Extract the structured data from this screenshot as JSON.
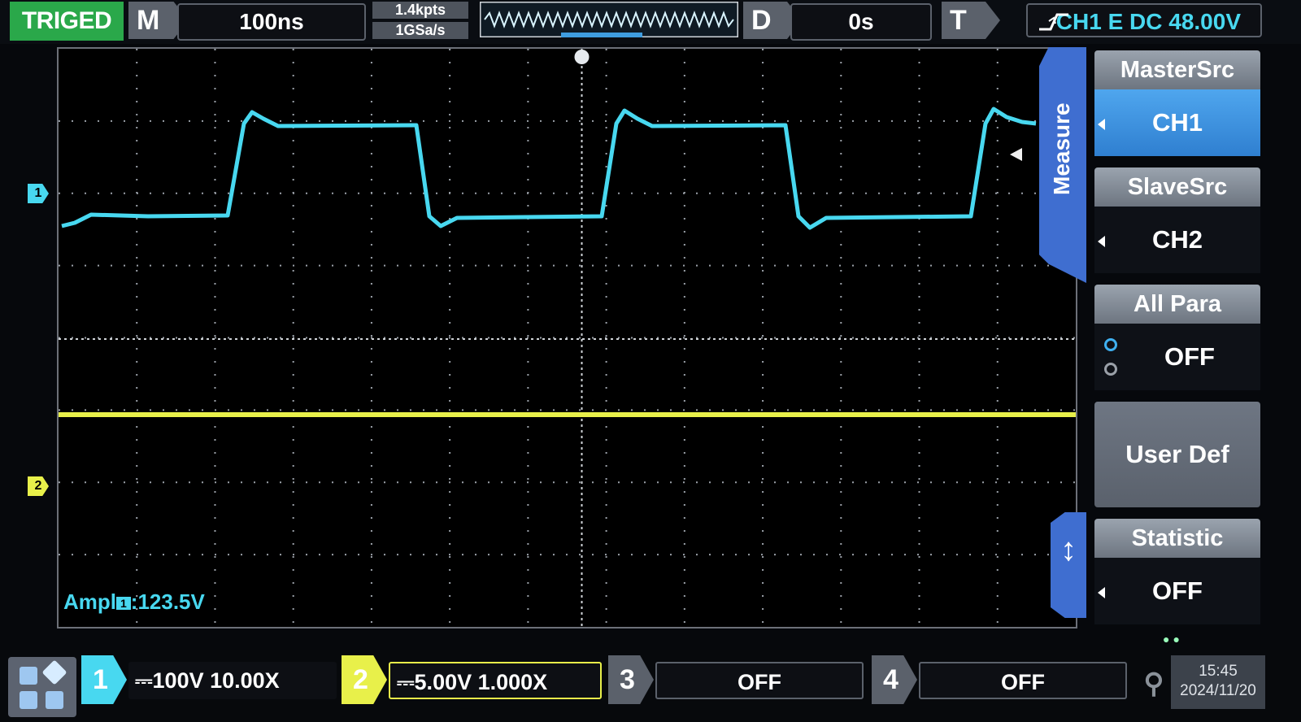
{
  "top_bar": {
    "trigger_status": "TRIGED",
    "timebase_tag": "M",
    "timebase_value": "100ns",
    "memory_depth": "1.4kpts",
    "sample_rate": "1GSa/s",
    "delay_tag": "D",
    "delay_value": "0s",
    "trigger_tag": "T",
    "trigger_source": "CH1 E DC 48.00V"
  },
  "waveform": {
    "ch1_marker": "1",
    "ch2_marker": "2",
    "trigger_marker": "T",
    "measurement_prefix": "Ampl",
    "measurement_channel": "1",
    "measurement_value": ":123.5V",
    "colors": {
      "ch1": "#48d8f0",
      "ch2": "#e8f04a",
      "grid": "#9aa0a8"
    }
  },
  "side_tab": {
    "label": "Measure"
  },
  "menu": {
    "master_src": {
      "label": "MasterSrc",
      "value": "CH1"
    },
    "slave_src": {
      "label": "SlaveSrc",
      "value": "CH2"
    },
    "all_para": {
      "label": "All Para",
      "value": "OFF"
    },
    "user_def": {
      "label": "User Def"
    },
    "statistic": {
      "label": "Statistic",
      "value": "OFF"
    }
  },
  "bottom_bar": {
    "channels": [
      {
        "num": "1",
        "setting": "⎓100V 10.00X",
        "color": "#48d8f0"
      },
      {
        "num": "2",
        "setting": "⎓5.00V 1.000X",
        "color": "#e8f04a"
      },
      {
        "num": "3",
        "setting": "OFF",
        "color": "#5b616b"
      },
      {
        "num": "4",
        "setting": "OFF",
        "color": "#5b616b"
      }
    ],
    "time": "15:45",
    "date": "2024/11/20"
  }
}
